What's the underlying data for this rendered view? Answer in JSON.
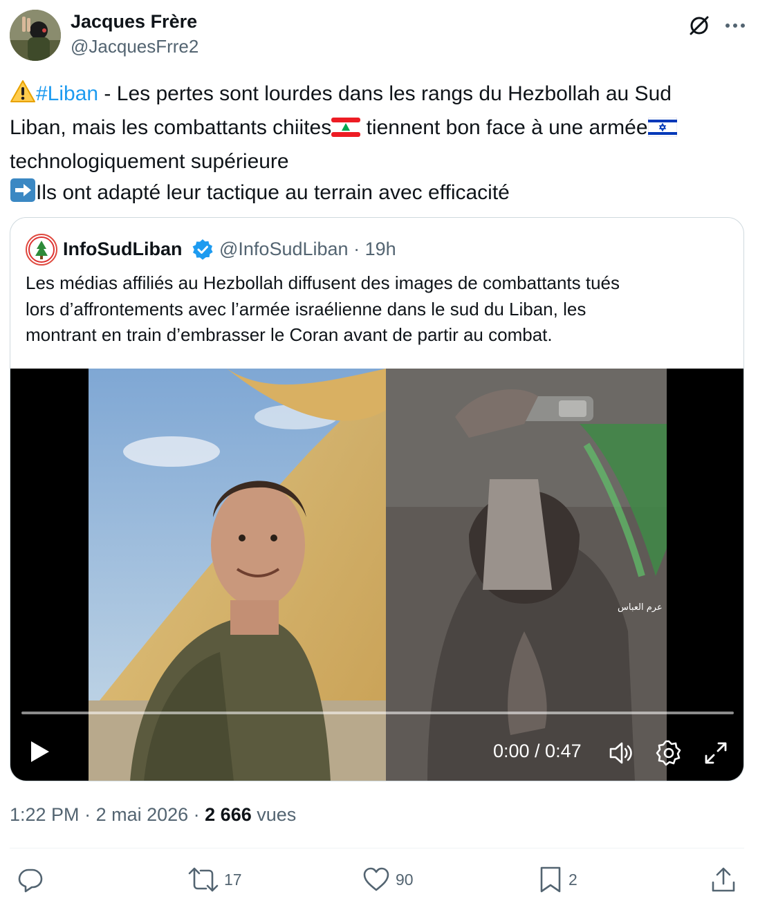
{
  "author": {
    "name": "Jacques Frère",
    "handle": "@JacquesFrre2"
  },
  "tweet": {
    "lines": [
      {
        "prefix_emoji": "warning-emoji",
        "hashtag": "#Liban",
        "text": " - Les pertes sont lourdes dans les rangs du Hezbollah au Sud"
      },
      {
        "text_before": "Liban, mais les combattants chiites",
        "flag1": "lebanon-flag-emoji",
        "text_middle": " tiennent bon face à une armée",
        "flag2": "israel-flag-emoji"
      },
      {
        "text": "technologiquement supérieure"
      },
      {
        "prefix_emoji": "right-arrow-emoji",
        "text": "Ils ont adapté leur tactique au terrain avec efficacité"
      }
    ]
  },
  "quote": {
    "name": "InfoSudLiban",
    "handle": "@InfoSudLiban",
    "separator": "·",
    "age": "19h",
    "verified": true,
    "lines": [
      "Les médias affiliés au Hezbollah diffusent des images de combattants tués",
      "lors d’affrontements avec l’armée israélienne dans le sud du Liban, les",
      "montrant en train d’embrasser le Coran avant de partir au combat."
    ],
    "video": {
      "time": "0:00 / 0:47",
      "progress": 0,
      "watermark": "عرم العباس"
    }
  },
  "meta": {
    "time": "1:22 PM",
    "sep1": " · ",
    "date": "2 mai 2026",
    "sep2": " · ",
    "views_count": "2 666",
    "views_label": " vues"
  },
  "actions": {
    "reply_count": "",
    "retweet_count": "17",
    "like_count": "90",
    "bookmark_count": "2"
  },
  "colors": {
    "link": "#1d9bf0",
    "secondary": "#536471",
    "primary": "#0f1419",
    "border": "#cfd9de",
    "verified": "#1d9bf0"
  }
}
